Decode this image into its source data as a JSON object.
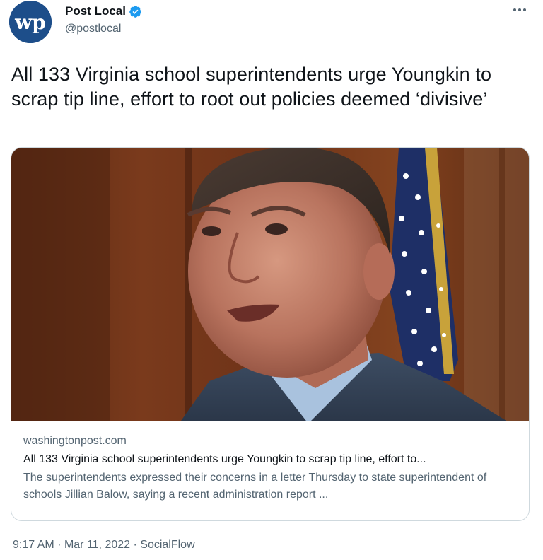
{
  "tweet": {
    "author": {
      "name": "Post Local",
      "handle": "@postlocal",
      "avatar_text": "wp",
      "verified": true,
      "avatar_color": "#1d4e8a",
      "verified_color": "#1d9bf0"
    },
    "text": "All 133 Virginia school superintendents urge Youngkin to scrap tip line, effort to root out policies deemed ‘divisive’",
    "card": {
      "domain": "washingtonpost.com",
      "title": "All 133 Virginia school superintendents urge Youngkin to scrap tip line, effort to...",
      "description": "The superintendents expressed their concerns in a letter Thursday to state superintendent of schools Jillian Balow, saying a recent administration report ..."
    },
    "meta": {
      "time": "9:17 AM",
      "date": "Mar 11, 2022",
      "source": "SocialFlow",
      "separator": "·"
    }
  }
}
